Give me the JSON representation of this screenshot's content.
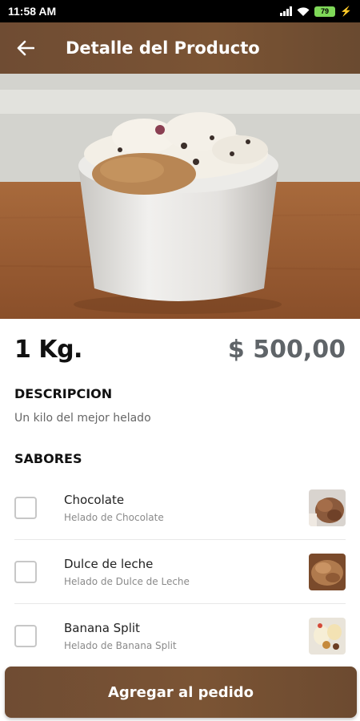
{
  "status_bar": {
    "time": "11:58 AM",
    "battery": "79",
    "icons": [
      "signal-icon",
      "wifi-icon",
      "battery-icon",
      "charging-bolt-icon"
    ]
  },
  "header": {
    "title": "Detalle del Producto",
    "back_icon": "arrow-left-icon",
    "color": "#7b5434"
  },
  "product": {
    "name": "1 Kg.",
    "price": "$ 500,00",
    "description_title": "DESCRIPCION",
    "description": "Un kilo del mejor helado"
  },
  "flavors": {
    "title": "SABORES",
    "items": [
      {
        "name": "Chocolate",
        "subtitle": "Helado de Chocolate",
        "checked": false
      },
      {
        "name": "Dulce de leche",
        "subtitle": "Helado de Dulce de Leche",
        "checked": false
      },
      {
        "name": "Banana Split",
        "subtitle": "Helado de Banana Split",
        "checked": false
      }
    ]
  },
  "cta": {
    "label": "Agregar al pedido",
    "color": "#7b5434"
  }
}
